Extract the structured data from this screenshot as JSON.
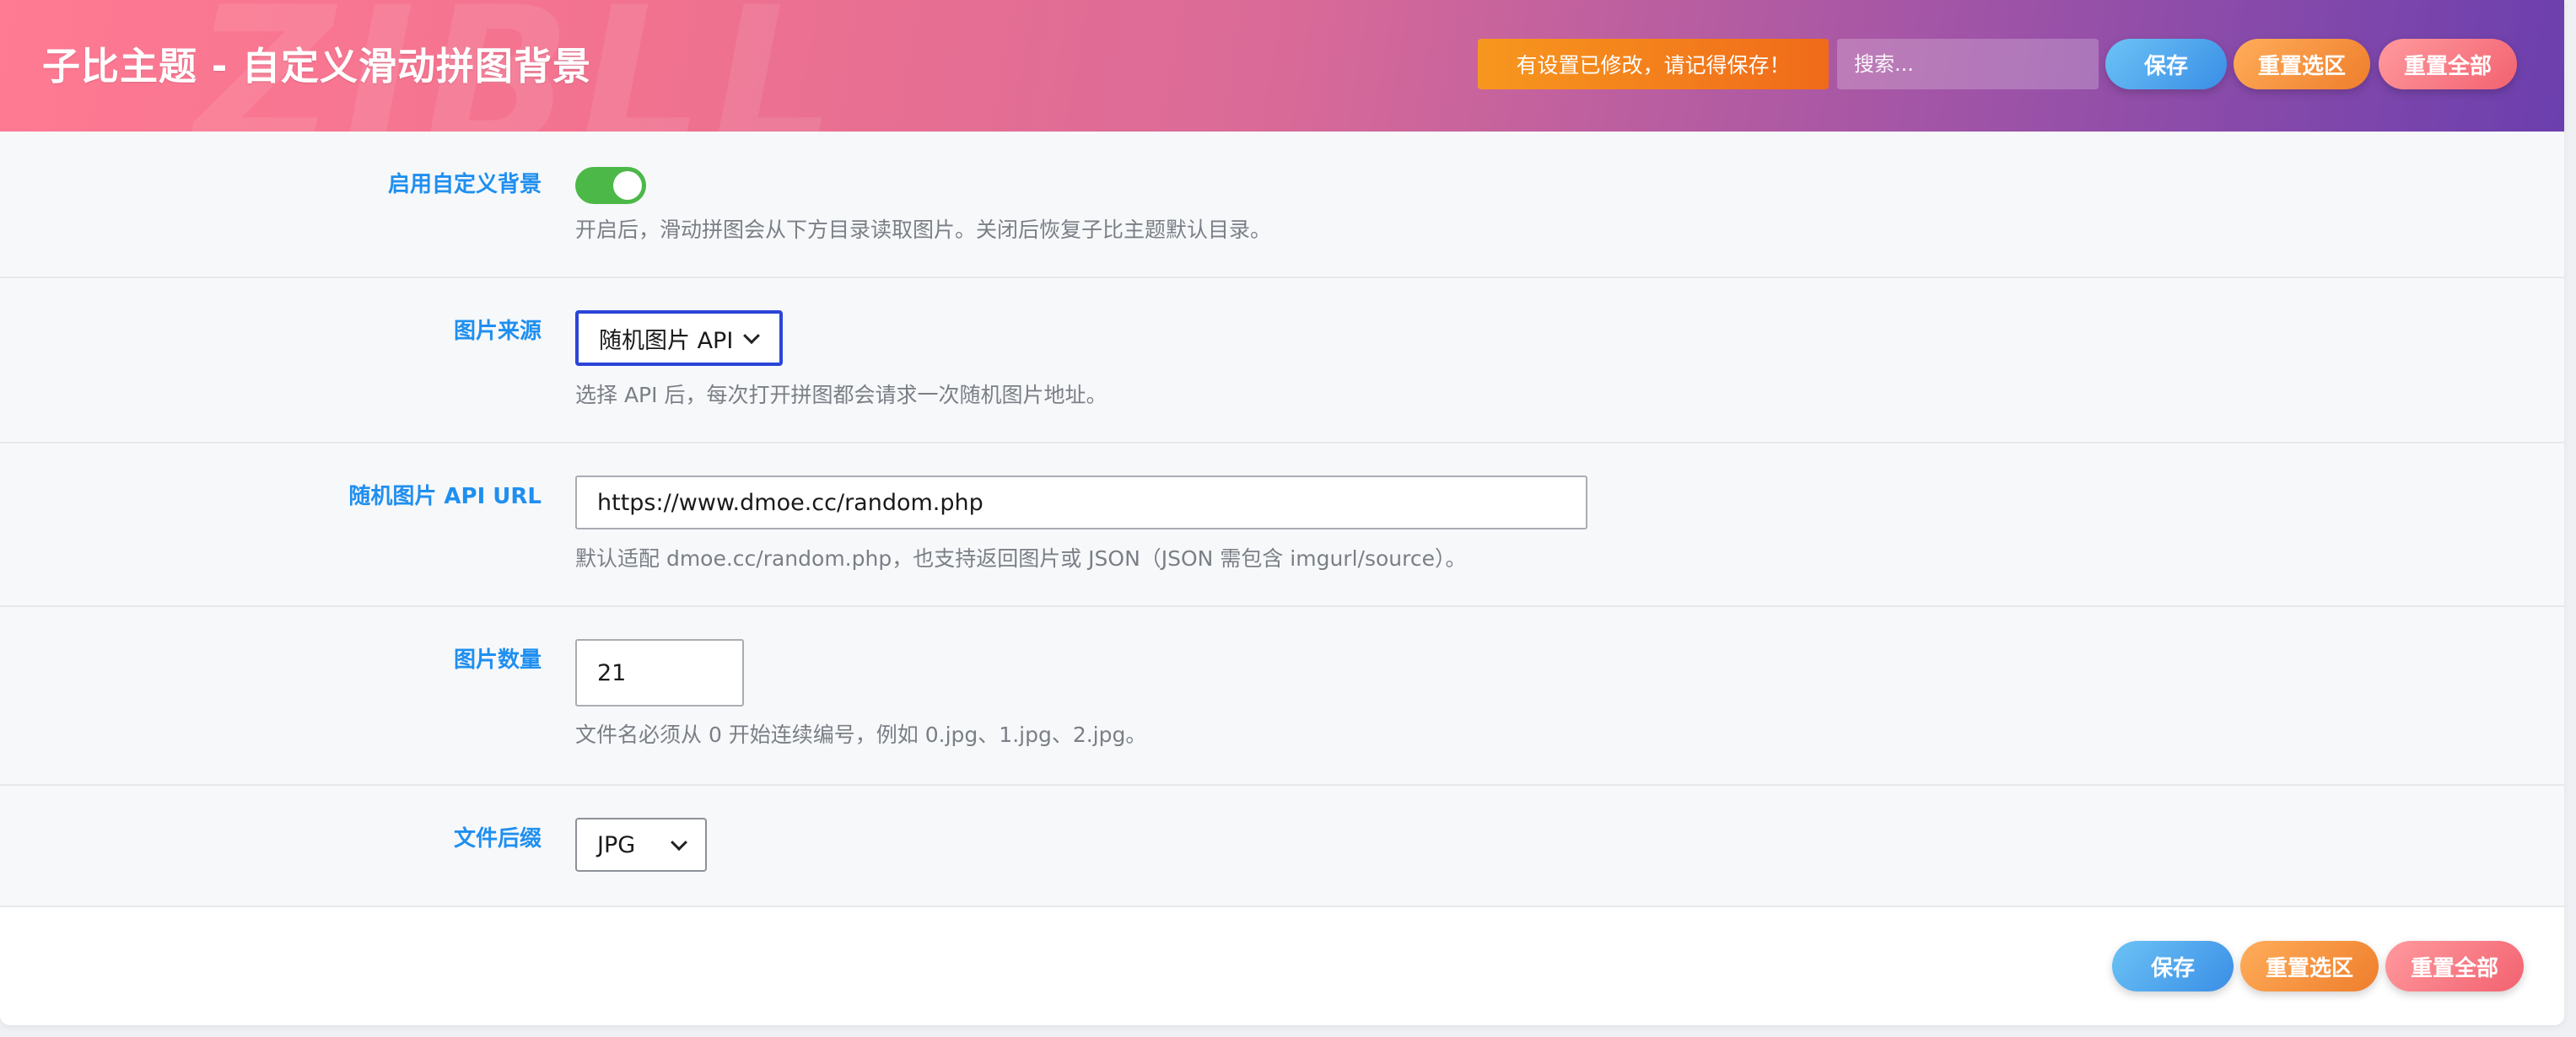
{
  "header": {
    "title": "子比主题 - 自定义滑动拼图背景",
    "watermark": "ZIBLL",
    "notice": "有设置已修改，请记得保存！",
    "search_placeholder": "搜索...",
    "save_label": "保存",
    "reset_section_label": "重置选区",
    "reset_all_label": "重置全部"
  },
  "fields": {
    "enable": {
      "label": "启用自定义背景",
      "toggle_on": true,
      "desc": "开启后，滑动拼图会从下方目录读取图片。关闭后恢复子比主题默认目录。"
    },
    "source": {
      "label": "图片来源",
      "value": "随机图片 API",
      "desc": "选择 API 后，每次打开拼图都会请求一次随机图片地址。"
    },
    "api_url": {
      "label": "随机图片 API URL",
      "value": "https://www.dmoe.cc/random.php",
      "desc": "默认适配 dmoe.cc/random.php，也支持返回图片或 JSON（JSON 需包含 imgurl/source）。"
    },
    "count": {
      "label": "图片数量",
      "value": "21",
      "desc": "文件名必须从 0 开始连续编号，例如 0.jpg、1.jpg、2.jpg。"
    },
    "suffix": {
      "label": "文件后缀",
      "value": "JPG"
    }
  },
  "footer": {
    "save_label": "保存",
    "reset_section_label": "重置选区",
    "reset_all_label": "重置全部"
  },
  "colors": {
    "accent_label": "#1f8ff0",
    "toggle_on": "#4cb848",
    "focus_border": "#2b45d8"
  }
}
